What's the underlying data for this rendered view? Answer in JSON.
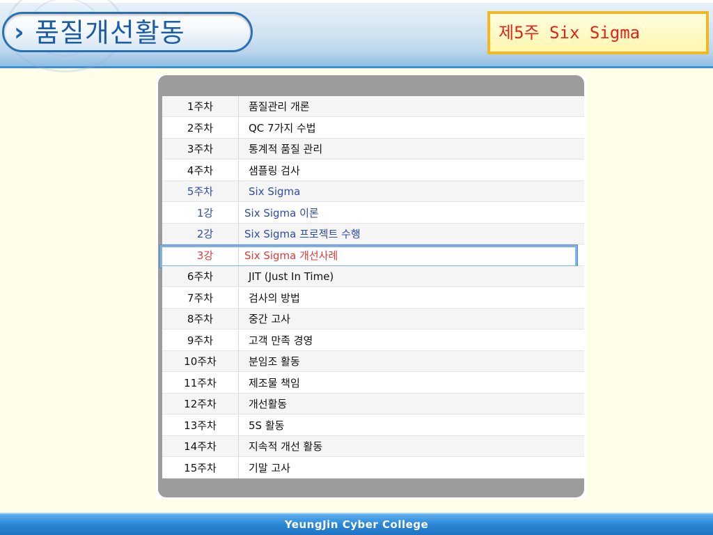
{
  "header": {
    "title": "품질개선활동",
    "week_label": "제5주 Six Sigma",
    "colors": {
      "title": "#1c5da9",
      "week_text": "#e2231a",
      "week_border": "#f2b824"
    }
  },
  "syllabus": {
    "rows": [
      {
        "week": "1주차",
        "topic": "품질관리 개론",
        "style": "normal"
      },
      {
        "week": "2주차",
        "topic": "QC 7가지 수법",
        "style": "normal"
      },
      {
        "week": "3주차",
        "topic": "통계적 품질 관리",
        "style": "normal"
      },
      {
        "week": "4주차",
        "topic": "샘플링 검사",
        "style": "normal"
      },
      {
        "week": "5주차",
        "topic": "Six Sigma",
        "style": "current-week"
      },
      {
        "week": "1강",
        "topic": "Six Sigma 이론",
        "style": "lecture"
      },
      {
        "week": "2강",
        "topic": "Six Sigma 프로젝트 수행",
        "style": "lecture"
      },
      {
        "week": "3강",
        "topic": "Six Sigma 개선사례",
        "style": "lecture-selected"
      },
      {
        "week": "6주차",
        "topic": "JIT (Just In Time)",
        "style": "normal"
      },
      {
        "week": "7주차",
        "topic": "검사의 방법",
        "style": "normal"
      },
      {
        "week": "8주차",
        "topic": "중간 고사",
        "style": "normal"
      },
      {
        "week": "9주차",
        "topic": "고객 만족 경영",
        "style": "normal"
      },
      {
        "week": "10주차",
        "topic": "분임조 활동",
        "style": "normal"
      },
      {
        "week": "11주차",
        "topic": "제조물 책임",
        "style": "normal"
      },
      {
        "week": "12주차",
        "topic": "개선활동",
        "style": "normal"
      },
      {
        "week": "13주차",
        "topic": "5S 활동",
        "style": "normal"
      },
      {
        "week": "14주차",
        "topic": "지속적 개선 활동",
        "style": "normal"
      },
      {
        "week": "15주차",
        "topic": "기말 고사",
        "style": "normal"
      }
    ],
    "colors": {
      "current": "#2f4ba8",
      "selected": "#e13a3a",
      "highlight_border": "#7fb2e4"
    }
  },
  "footer": {
    "text": "YeungJin Cyber College"
  }
}
